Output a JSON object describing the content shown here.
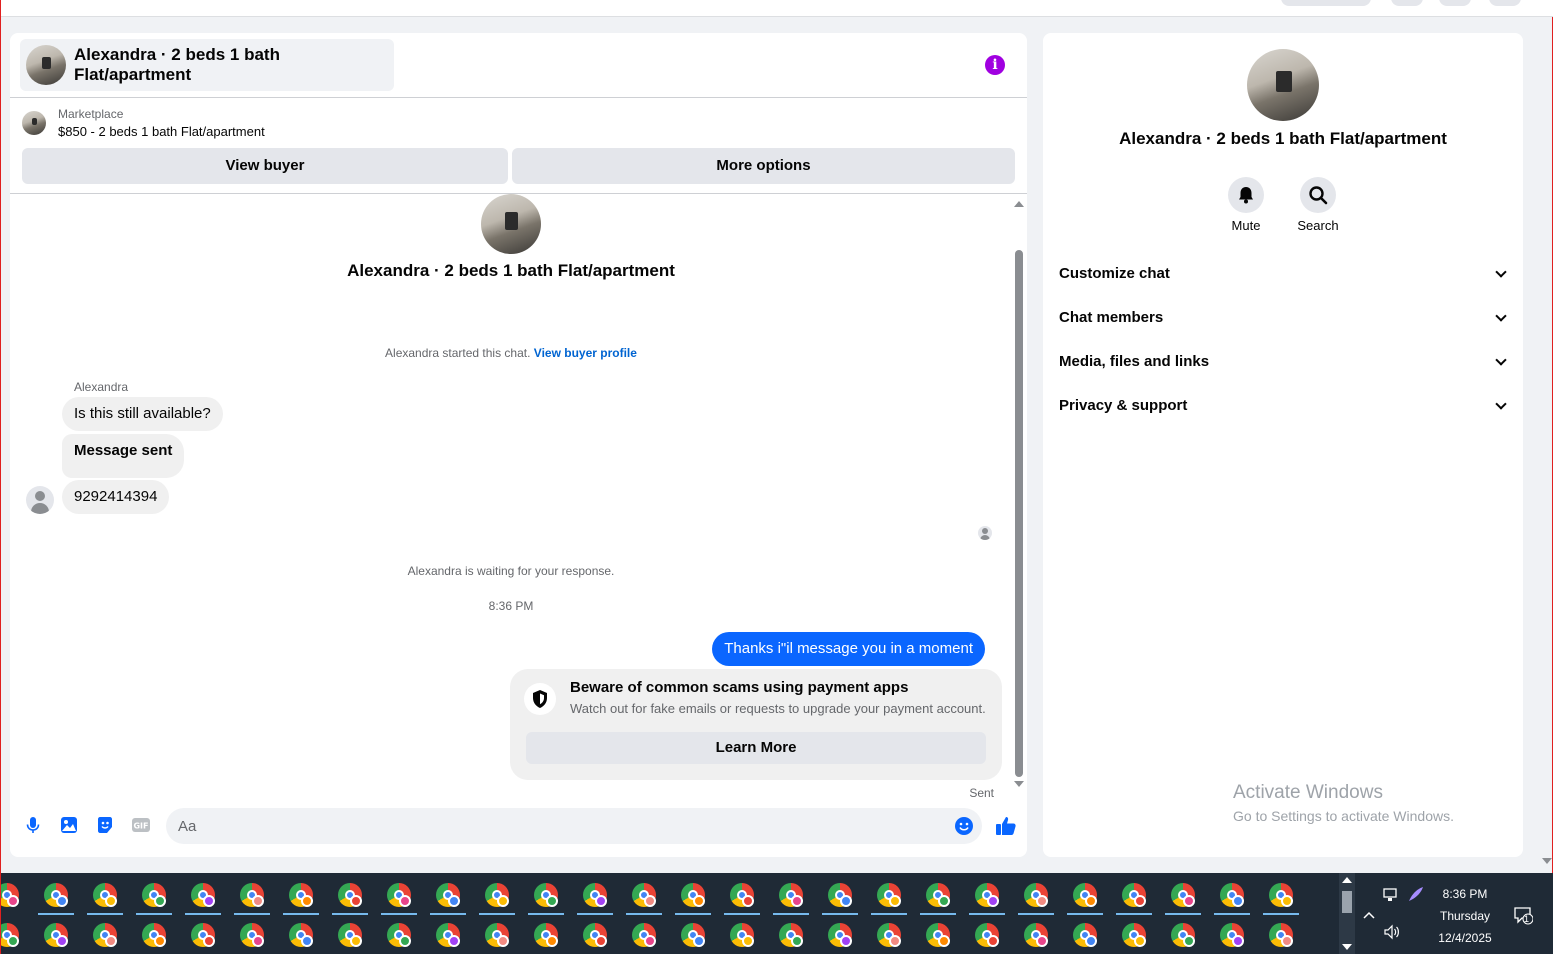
{
  "colors": {
    "accent": "#0a66ff",
    "info_icon": "#a000e0",
    "link": "#0064d1",
    "taskbar": "#1f2a36"
  },
  "chat": {
    "header_title": "Alexandra · 2 beds 1 bath Flat/apartment",
    "info_icon": "info-icon",
    "marketplace_label": "Marketplace",
    "listing": "$850 - 2 beds 1 bath Flat/apartment",
    "view_buyer_label": "View buyer",
    "more_options_label": "More options",
    "conversation_title": "Alexandra · 2 beds 1 bath Flat/apartment",
    "started_text": "Alexandra started this chat.",
    "view_buyer_profile_link": "View buyer profile",
    "sender_name": "Alexandra",
    "incoming_messages": [
      "Is this still available?",
      "Message sent",
      "9292414394"
    ],
    "waiting_text": "Alexandra is waiting for your response.",
    "timestamp": "8:36 PM",
    "outgoing_message": "Thanks i\"il message you in a moment",
    "scam_title": "Beware of common scams using payment apps",
    "scam_subtitle": "Watch out for fake emails or requests to upgrade your payment account.",
    "learn_more_label": "Learn More",
    "sent_status": "Sent",
    "composer_placeholder": "Aa",
    "composer_icons": [
      "microphone-icon",
      "photo-icon",
      "sticker-icon",
      "gif-icon",
      "emoji-icon",
      "thumbs-up-icon"
    ]
  },
  "side": {
    "title": "Alexandra · 2 beds 1 bath Flat/apartment",
    "mute_label": "Mute",
    "search_label": "Search",
    "menu": [
      "Customize chat",
      "Chat members",
      "Media, files and links",
      "Privacy & support"
    ]
  },
  "watermark": {
    "line1": "Activate Windows",
    "line2": "Go to Settings to activate Windows."
  },
  "taskbar": {
    "time": "8:36 PM",
    "day": "Thursday",
    "date": "12/4/2025",
    "notification_count": "1",
    "badge_colors": [
      "#e8458b",
      "#4285f4",
      "#fbbc05",
      "#34a853",
      "#a142f4",
      "#f28b82",
      "#ff8a00",
      "#ea4335"
    ]
  }
}
